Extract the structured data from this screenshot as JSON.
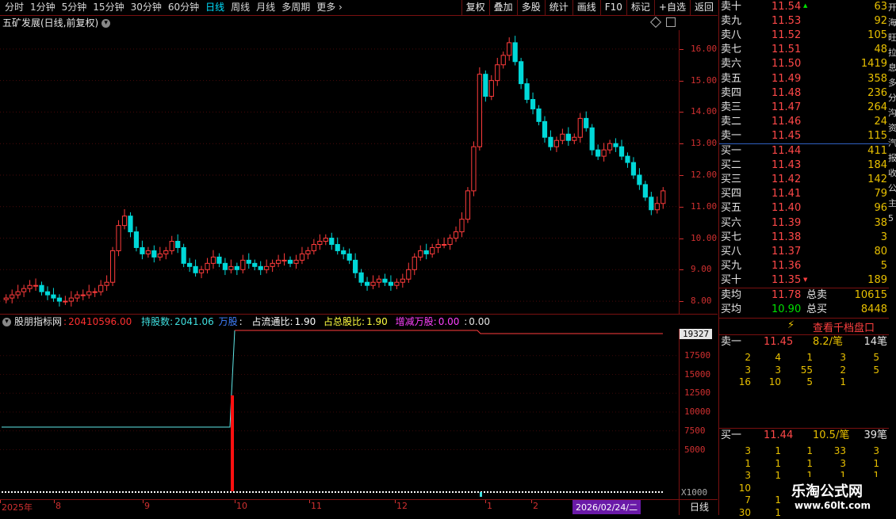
{
  "toolbar": {
    "periods": [
      "分时",
      "1分钟",
      "5分钟",
      "15分钟",
      "30分钟",
      "60分钟",
      "日线",
      "周线",
      "月线",
      "多周期",
      "更多"
    ],
    "active_period": "日线",
    "tools": [
      "复权",
      "叠加",
      "多股",
      "统计",
      "画线",
      "F10",
      "标记",
      "+自选",
      "返回"
    ]
  },
  "chart": {
    "title": "五矿发展(日线,前复权)",
    "y_labels": [
      "16.00",
      "15.00",
      "14.00",
      "13.00",
      "12.00",
      "11.00",
      "10.00",
      "9.00",
      "8.00"
    ]
  },
  "chart_data": {
    "type": "candlestick",
    "title": "五矿发展(日线,前复权)",
    "ylim": [
      7.6,
      16.6
    ],
    "months": [
      "2025年",
      "8",
      "9",
      "10",
      "11",
      "12",
      "1",
      "2"
    ],
    "closes": [
      8.1,
      8.2,
      8.3,
      8.4,
      8.5,
      8.5,
      8.3,
      8.2,
      8.1,
      8.0,
      8.0,
      8.1,
      8.2,
      8.2,
      8.3,
      8.3,
      8.5,
      8.6,
      9.6,
      10.4,
      10.7,
      10.2,
      9.7,
      9.5,
      9.6,
      9.4,
      9.5,
      9.6,
      9.9,
      9.7,
      9.2,
      9.1,
      8.9,
      9.0,
      9.2,
      9.4,
      9.2,
      9.0,
      9.1,
      9.0,
      9.3,
      9.2,
      9.1,
      9.0,
      9.1,
      9.2,
      9.3,
      9.3,
      9.2,
      9.3,
      9.5,
      9.6,
      9.8,
      9.9,
      10.0,
      9.8,
      9.6,
      9.5,
      9.3,
      8.9,
      8.6,
      8.5,
      8.6,
      8.7,
      8.6,
      8.5,
      8.6,
      8.7,
      9.0,
      9.4,
      9.6,
      9.5,
      9.7,
      9.8,
      9.8,
      10.0,
      10.2,
      10.6,
      11.5,
      12.9,
      15.2,
      14.5,
      15.0,
      15.5,
      15.8,
      16.2,
      15.6,
      14.9,
      14.4,
      14.1,
      13.7,
      13.2,
      12.9,
      13.1,
      13.3,
      13.1,
      13.2,
      13.8,
      13.5,
      12.8,
      12.6,
      12.8,
      13.0,
      12.9,
      12.6,
      12.4,
      12.0,
      11.7,
      11.3,
      10.9,
      11.1,
      11.5
    ],
    "indicator": {
      "name": "股朋指标网",
      "value": "20410596.00",
      "holdings_label": "持股数:",
      "holdings": "2041.06",
      "holdings_unit": "万股",
      "float_ratio_label": "占流通比:",
      "float_ratio": "1.90",
      "total_ratio_label": "占总股比:",
      "total_ratio": "1.90",
      "change_label": "增减万股:",
      "change": "0.00",
      "change2": "0.00",
      "y_labels": [
        "19327",
        "17500",
        "15000",
        "12500",
        "10000",
        "7500",
        "5000"
      ],
      "scale_note": "X1000"
    }
  },
  "bottom": {
    "months": [
      "2025年",
      "8",
      "9",
      "10",
      "11",
      "12",
      "1",
      "2"
    ],
    "date_badge": "2026/02/24/二",
    "period_btn": "日线"
  },
  "orderbook": {
    "asks": [
      {
        "label": "卖十",
        "price": "11.54",
        "vol": "63"
      },
      {
        "label": "卖九",
        "price": "11.53",
        "vol": "92"
      },
      {
        "label": "卖八",
        "price": "11.52",
        "vol": "105"
      },
      {
        "label": "卖七",
        "price": "11.51",
        "vol": "48"
      },
      {
        "label": "卖六",
        "price": "11.50",
        "vol": "1419"
      },
      {
        "label": "卖五",
        "price": "11.49",
        "vol": "358"
      },
      {
        "label": "卖四",
        "price": "11.48",
        "vol": "236"
      },
      {
        "label": "卖三",
        "price": "11.47",
        "vol": "264"
      },
      {
        "label": "卖二",
        "price": "11.46",
        "vol": "24"
      },
      {
        "label": "卖一",
        "price": "11.45",
        "vol": "115"
      }
    ],
    "bids": [
      {
        "label": "买一",
        "price": "11.44",
        "vol": "411"
      },
      {
        "label": "买二",
        "price": "11.43",
        "vol": "184"
      },
      {
        "label": "买三",
        "price": "11.42",
        "vol": "142"
      },
      {
        "label": "买四",
        "price": "11.41",
        "vol": "79"
      },
      {
        "label": "买五",
        "price": "11.40",
        "vol": "96"
      },
      {
        "label": "买六",
        "price": "11.39",
        "vol": "38"
      },
      {
        "label": "买七",
        "price": "11.38",
        "vol": "3"
      },
      {
        "label": "买八",
        "price": "11.37",
        "vol": "80"
      },
      {
        "label": "买九",
        "price": "11.36",
        "vol": "5"
      },
      {
        "label": "买十",
        "price": "11.35",
        "vol": "189"
      }
    ],
    "avg_ask": {
      "label": "卖均",
      "price": "11.78",
      "total_label": "总卖",
      "total": "10615"
    },
    "avg_bid": {
      "label": "买均",
      "price": "10.90",
      "total_label": "总买",
      "total": "8448"
    },
    "thousand_btn": "查看千档盘口",
    "ask1_detail": {
      "label": "卖一",
      "price": "11.45",
      "per": "8.2/笔",
      "count": "14笔"
    },
    "ask_queue": [
      [
        "2",
        "4",
        "1",
        "3",
        "5"
      ],
      [
        "3",
        "3",
        "55",
        "2",
        "5"
      ],
      [
        "16",
        "10",
        "5",
        "1",
        ""
      ]
    ],
    "bid1_detail": {
      "label": "买一",
      "price": "11.44",
      "per": "10.5/笔",
      "count": "39笔"
    },
    "bid_queue": [
      [
        "3",
        "1",
        "1",
        "33",
        "3"
      ],
      [
        "1",
        "1",
        "1",
        "3",
        "1"
      ],
      [
        "3",
        "1",
        "1",
        "1",
        "1"
      ],
      [
        "10",
        "",
        "",
        "",
        ""
      ],
      [
        "7",
        "1",
        "",
        "",
        ""
      ],
      [
        "30",
        "1",
        "",
        "",
        ""
      ]
    ]
  },
  "watermark": {
    "title": "乐淘公式网",
    "url": "www.60lt.com"
  },
  "side_strip": [
    "开",
    "海",
    "旺",
    "拉",
    "息",
    "多",
    "分",
    "沟",
    "资",
    "汽",
    "报",
    "收",
    "公",
    "主",
    "5"
  ]
}
